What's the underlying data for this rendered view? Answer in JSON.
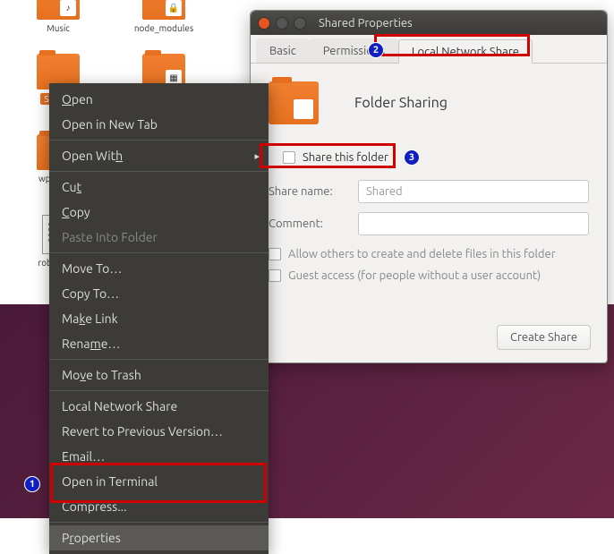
{
  "desktop": {
    "icons": [
      {
        "label": "Music",
        "type": "folder",
        "badge": "♪"
      },
      {
        "label": "node_modules",
        "type": "folder",
        "badge": "🔒"
      },
      {
        "label": "Shared",
        "type": "folder",
        "badge": "",
        "selected": true
      },
      {
        "label": "",
        "type": "folder",
        "badge": ""
      },
      {
        "label": "wpsoffice",
        "type": "folder",
        "badge": ""
      },
      {
        "label": "",
        "type": "folder",
        "badge": ""
      },
      {
        "label": "robots.txt",
        "type": "doc"
      }
    ]
  },
  "context_menu": {
    "open": "Open",
    "open_new_tab": "Open in New Tab",
    "open_with": "Open With",
    "cut": "Cut",
    "copy": "Copy",
    "paste_into": "Paste Into Folder",
    "move_to": "Move To…",
    "copy_to": "Copy To…",
    "make_link": "Make Link",
    "rename": "Rename…",
    "move_trash": "Move to Trash",
    "local_share": "Local Network Share",
    "revert": "Revert to Previous Version…",
    "email": "Email…",
    "terminal": "Open in Terminal",
    "compress": "Compress...",
    "properties": "Properties"
  },
  "dialog": {
    "title": "Shared Properties",
    "tabs": {
      "basic": "Basic",
      "permissions": "Permissions",
      "share": "Local Network Share"
    },
    "heading": "Folder Sharing",
    "share_this": "Share this folder",
    "share_name_label": "Share name:",
    "share_name_value": "Shared",
    "comment_label": "Comment:",
    "comment_value": "",
    "allow_others": "Allow others to create and delete files in this folder",
    "guest_access": "Guest access (for people without a user account)",
    "create_btn": "Create Share"
  },
  "annotations": {
    "n1": "1",
    "n2": "2",
    "n3": "3"
  }
}
